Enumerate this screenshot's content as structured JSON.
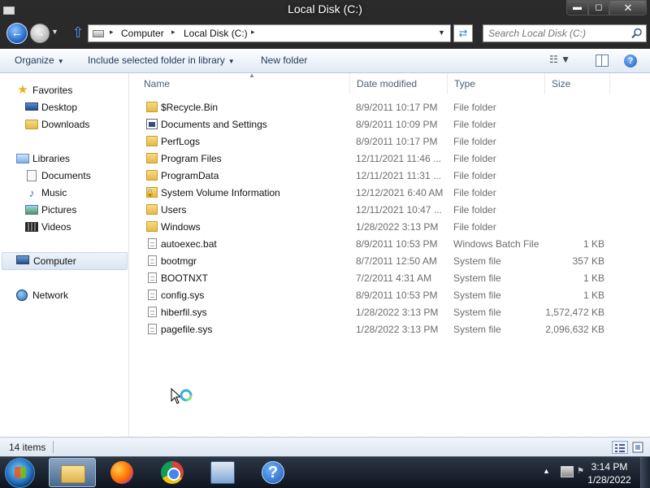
{
  "window": {
    "title": "Local Disk (C:)",
    "controls": {
      "minimize": "▬",
      "maximize": "◻",
      "close": "✕"
    }
  },
  "nav": {
    "back_glyph": "←",
    "forward_glyph": "→",
    "up_glyph": "⇧",
    "refresh_glyph": "⇄",
    "dropdown_glyph": "▼"
  },
  "address": {
    "sep": "▸",
    "crumbs": [
      "Computer",
      "Local Disk (C:)"
    ]
  },
  "search": {
    "placeholder": "Search Local Disk (C:)"
  },
  "toolbar": {
    "organize": "Organize",
    "include": "Include selected folder in library",
    "new_folder": "New folder",
    "caret": "▼",
    "view_glyph": "☷ ▼",
    "help_glyph": "?"
  },
  "sidebar": {
    "favorites": {
      "label": "Favorites",
      "icon": "star-icon",
      "items": [
        {
          "label": "Desktop",
          "icon": "desktop-icon"
        },
        {
          "label": "Downloads",
          "icon": "downloads-folder-icon"
        }
      ]
    },
    "libraries": {
      "label": "Libraries",
      "icon": "library-icon",
      "items": [
        {
          "label": "Documents",
          "icon": "documents-icon"
        },
        {
          "label": "Music",
          "icon": "music-icon"
        },
        {
          "label": "Pictures",
          "icon": "pictures-icon"
        },
        {
          "label": "Videos",
          "icon": "videos-icon"
        }
      ]
    },
    "computer": {
      "label": "Computer",
      "icon": "computer-icon",
      "selected": true
    },
    "network": {
      "label": "Network",
      "icon": "network-icon"
    }
  },
  "columns": {
    "name": "Name",
    "date": "Date modified",
    "type": "Type",
    "size": "Size",
    "sort_glyph": "▲"
  },
  "files": [
    {
      "name": "$Recycle.Bin",
      "date": "8/9/2011 10:17 PM",
      "type": "File folder",
      "size": "",
      "icon": "folder-icon"
    },
    {
      "name": "Documents and Settings",
      "date": "8/9/2011 10:09 PM",
      "type": "File folder",
      "size": "",
      "icon": "shortcut-folder-icon"
    },
    {
      "name": "PerfLogs",
      "date": "8/9/2011 10:17 PM",
      "type": "File folder",
      "size": "",
      "icon": "folder-icon"
    },
    {
      "name": "Program Files",
      "date": "12/11/2021 11:46 ...",
      "type": "File folder",
      "size": "",
      "icon": "folder-icon"
    },
    {
      "name": "ProgramData",
      "date": "12/11/2021 11:31 ...",
      "type": "File folder",
      "size": "",
      "icon": "folder-icon"
    },
    {
      "name": "System Volume Information",
      "date": "12/12/2021 6:40 AM",
      "type": "File folder",
      "size": "",
      "icon": "locked-folder-icon"
    },
    {
      "name": "Users",
      "date": "12/11/2021 10:47 ...",
      "type": "File folder",
      "size": "",
      "icon": "folder-icon"
    },
    {
      "name": "Windows",
      "date": "1/28/2022 3:13 PM",
      "type": "File folder",
      "size": "",
      "icon": "folder-icon"
    },
    {
      "name": "autoexec.bat",
      "date": "8/9/2011 10:53 PM",
      "type": "Windows Batch File",
      "size": "1 KB",
      "icon": "batch-file-icon"
    },
    {
      "name": "bootmgr",
      "date": "8/7/2011 12:50 AM",
      "type": "System file",
      "size": "357 KB",
      "icon": "system-file-icon"
    },
    {
      "name": "BOOTNXT",
      "date": "7/2/2011 4:31 AM",
      "type": "System file",
      "size": "1 KB",
      "icon": "system-file-icon"
    },
    {
      "name": "config.sys",
      "date": "8/9/2011 10:53 PM",
      "type": "System file",
      "size": "1 KB",
      "icon": "system-file-icon"
    },
    {
      "name": "hiberfil.sys",
      "date": "1/28/2022 3:13 PM",
      "type": "System file",
      "size": "1,572,472 KB",
      "icon": "system-file-icon"
    },
    {
      "name": "pagefile.sys",
      "date": "1/28/2022 3:13 PM",
      "type": "System file",
      "size": "2,096,632 KB",
      "icon": "system-file-icon"
    }
  ],
  "status": {
    "count": "14 items"
  },
  "taskbar": {
    "apps": [
      {
        "name": "windows-explorer",
        "icon": "explorer-icon",
        "active": true
      },
      {
        "name": "firefox",
        "icon": "firefox-icon",
        "active": false
      },
      {
        "name": "chrome",
        "icon": "chrome-icon",
        "active": false
      },
      {
        "name": "control-panel",
        "icon": "control-panel-icon",
        "active": false
      },
      {
        "name": "help",
        "icon": "help-icon",
        "active": false
      }
    ],
    "tray_up_glyph": "▲",
    "time": "3:14 PM",
    "date": "1/28/2022"
  }
}
